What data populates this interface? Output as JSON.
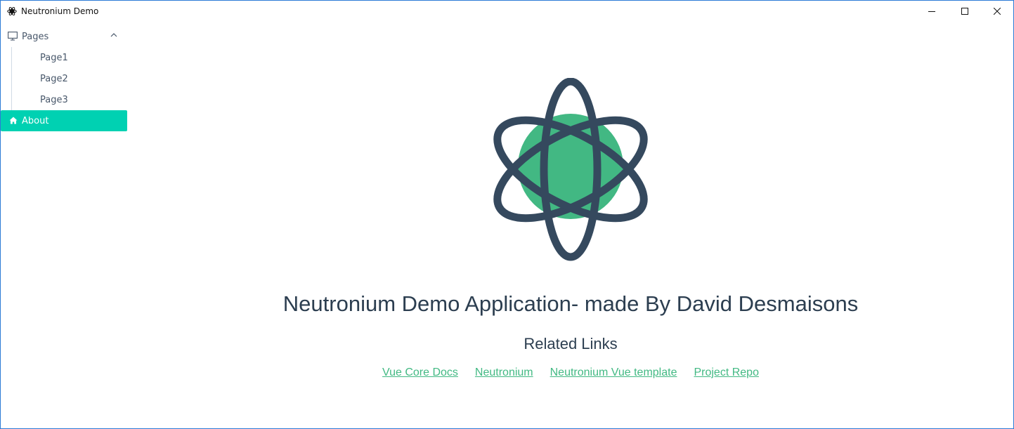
{
  "window": {
    "title": "Neutronium Demo",
    "controls": [
      "minimize",
      "maximize",
      "close"
    ]
  },
  "sidebar": {
    "group": {
      "label": "Pages",
      "icon": "monitor-icon",
      "expanded": true,
      "items": [
        {
          "label": "Page1"
        },
        {
          "label": "Page2"
        },
        {
          "label": "Page3"
        }
      ]
    },
    "active_item": {
      "label": "About",
      "icon": "home-icon"
    }
  },
  "main": {
    "headline": "Neutronium Demo Application- made By David Desmaisons",
    "related_title": "Related Links",
    "links": [
      {
        "label": "Vue Core Docs"
      },
      {
        "label": "Neutronium"
      },
      {
        "label": "Neutronium Vue template"
      },
      {
        "label": "Project Repo"
      }
    ]
  },
  "colors": {
    "accent": "#00d1b2",
    "link": "#42b983",
    "text": "#2c3e50",
    "logo_green": "#42b883",
    "logo_dark": "#35495e"
  }
}
